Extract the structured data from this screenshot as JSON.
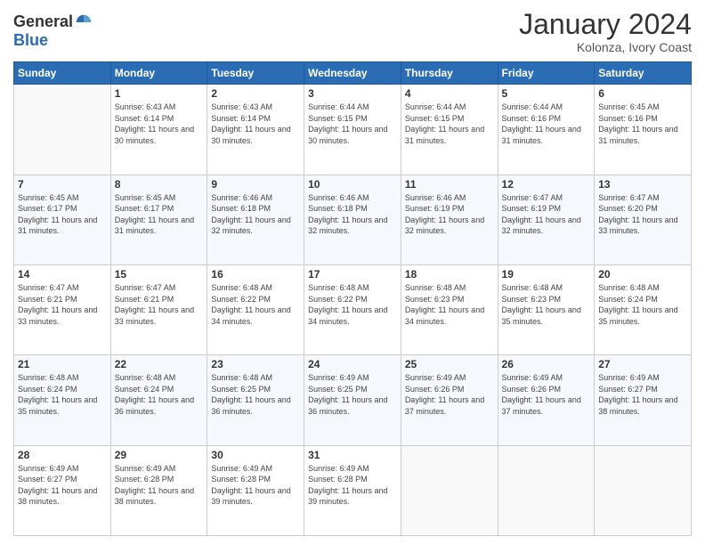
{
  "header": {
    "logo_general": "General",
    "logo_blue": "Blue",
    "month": "January 2024",
    "location": "Kolonza, Ivory Coast"
  },
  "weekdays": [
    "Sunday",
    "Monday",
    "Tuesday",
    "Wednesday",
    "Thursday",
    "Friday",
    "Saturday"
  ],
  "weeks": [
    [
      {
        "day": "",
        "sunrise": "",
        "sunset": "",
        "daylight": ""
      },
      {
        "day": "1",
        "sunrise": "Sunrise: 6:43 AM",
        "sunset": "Sunset: 6:14 PM",
        "daylight": "Daylight: 11 hours and 30 minutes."
      },
      {
        "day": "2",
        "sunrise": "Sunrise: 6:43 AM",
        "sunset": "Sunset: 6:14 PM",
        "daylight": "Daylight: 11 hours and 30 minutes."
      },
      {
        "day": "3",
        "sunrise": "Sunrise: 6:44 AM",
        "sunset": "Sunset: 6:15 PM",
        "daylight": "Daylight: 11 hours and 30 minutes."
      },
      {
        "day": "4",
        "sunrise": "Sunrise: 6:44 AM",
        "sunset": "Sunset: 6:15 PM",
        "daylight": "Daylight: 11 hours and 31 minutes."
      },
      {
        "day": "5",
        "sunrise": "Sunrise: 6:44 AM",
        "sunset": "Sunset: 6:16 PM",
        "daylight": "Daylight: 11 hours and 31 minutes."
      },
      {
        "day": "6",
        "sunrise": "Sunrise: 6:45 AM",
        "sunset": "Sunset: 6:16 PM",
        "daylight": "Daylight: 11 hours and 31 minutes."
      }
    ],
    [
      {
        "day": "7",
        "sunrise": "Sunrise: 6:45 AM",
        "sunset": "Sunset: 6:17 PM",
        "daylight": "Daylight: 11 hours and 31 minutes."
      },
      {
        "day": "8",
        "sunrise": "Sunrise: 6:45 AM",
        "sunset": "Sunset: 6:17 PM",
        "daylight": "Daylight: 11 hours and 31 minutes."
      },
      {
        "day": "9",
        "sunrise": "Sunrise: 6:46 AM",
        "sunset": "Sunset: 6:18 PM",
        "daylight": "Daylight: 11 hours and 32 minutes."
      },
      {
        "day": "10",
        "sunrise": "Sunrise: 6:46 AM",
        "sunset": "Sunset: 6:18 PM",
        "daylight": "Daylight: 11 hours and 32 minutes."
      },
      {
        "day": "11",
        "sunrise": "Sunrise: 6:46 AM",
        "sunset": "Sunset: 6:19 PM",
        "daylight": "Daylight: 11 hours and 32 minutes."
      },
      {
        "day": "12",
        "sunrise": "Sunrise: 6:47 AM",
        "sunset": "Sunset: 6:19 PM",
        "daylight": "Daylight: 11 hours and 32 minutes."
      },
      {
        "day": "13",
        "sunrise": "Sunrise: 6:47 AM",
        "sunset": "Sunset: 6:20 PM",
        "daylight": "Daylight: 11 hours and 33 minutes."
      }
    ],
    [
      {
        "day": "14",
        "sunrise": "Sunrise: 6:47 AM",
        "sunset": "Sunset: 6:21 PM",
        "daylight": "Daylight: 11 hours and 33 minutes."
      },
      {
        "day": "15",
        "sunrise": "Sunrise: 6:47 AM",
        "sunset": "Sunset: 6:21 PM",
        "daylight": "Daylight: 11 hours and 33 minutes."
      },
      {
        "day": "16",
        "sunrise": "Sunrise: 6:48 AM",
        "sunset": "Sunset: 6:22 PM",
        "daylight": "Daylight: 11 hours and 34 minutes."
      },
      {
        "day": "17",
        "sunrise": "Sunrise: 6:48 AM",
        "sunset": "Sunset: 6:22 PM",
        "daylight": "Daylight: 11 hours and 34 minutes."
      },
      {
        "day": "18",
        "sunrise": "Sunrise: 6:48 AM",
        "sunset": "Sunset: 6:23 PM",
        "daylight": "Daylight: 11 hours and 34 minutes."
      },
      {
        "day": "19",
        "sunrise": "Sunrise: 6:48 AM",
        "sunset": "Sunset: 6:23 PM",
        "daylight": "Daylight: 11 hours and 35 minutes."
      },
      {
        "day": "20",
        "sunrise": "Sunrise: 6:48 AM",
        "sunset": "Sunset: 6:24 PM",
        "daylight": "Daylight: 11 hours and 35 minutes."
      }
    ],
    [
      {
        "day": "21",
        "sunrise": "Sunrise: 6:48 AM",
        "sunset": "Sunset: 6:24 PM",
        "daylight": "Daylight: 11 hours and 35 minutes."
      },
      {
        "day": "22",
        "sunrise": "Sunrise: 6:48 AM",
        "sunset": "Sunset: 6:24 PM",
        "daylight": "Daylight: 11 hours and 36 minutes."
      },
      {
        "day": "23",
        "sunrise": "Sunrise: 6:48 AM",
        "sunset": "Sunset: 6:25 PM",
        "daylight": "Daylight: 11 hours and 36 minutes."
      },
      {
        "day": "24",
        "sunrise": "Sunrise: 6:49 AM",
        "sunset": "Sunset: 6:25 PM",
        "daylight": "Daylight: 11 hours and 36 minutes."
      },
      {
        "day": "25",
        "sunrise": "Sunrise: 6:49 AM",
        "sunset": "Sunset: 6:26 PM",
        "daylight": "Daylight: 11 hours and 37 minutes."
      },
      {
        "day": "26",
        "sunrise": "Sunrise: 6:49 AM",
        "sunset": "Sunset: 6:26 PM",
        "daylight": "Daylight: 11 hours and 37 minutes."
      },
      {
        "day": "27",
        "sunrise": "Sunrise: 6:49 AM",
        "sunset": "Sunset: 6:27 PM",
        "daylight": "Daylight: 11 hours and 38 minutes."
      }
    ],
    [
      {
        "day": "28",
        "sunrise": "Sunrise: 6:49 AM",
        "sunset": "Sunset: 6:27 PM",
        "daylight": "Daylight: 11 hours and 38 minutes."
      },
      {
        "day": "29",
        "sunrise": "Sunrise: 6:49 AM",
        "sunset": "Sunset: 6:28 PM",
        "daylight": "Daylight: 11 hours and 38 minutes."
      },
      {
        "day": "30",
        "sunrise": "Sunrise: 6:49 AM",
        "sunset": "Sunset: 6:28 PM",
        "daylight": "Daylight: 11 hours and 39 minutes."
      },
      {
        "day": "31",
        "sunrise": "Sunrise: 6:49 AM",
        "sunset": "Sunset: 6:28 PM",
        "daylight": "Daylight: 11 hours and 39 minutes."
      },
      {
        "day": "",
        "sunrise": "",
        "sunset": "",
        "daylight": ""
      },
      {
        "day": "",
        "sunrise": "",
        "sunset": "",
        "daylight": ""
      },
      {
        "day": "",
        "sunrise": "",
        "sunset": "",
        "daylight": ""
      }
    ]
  ]
}
